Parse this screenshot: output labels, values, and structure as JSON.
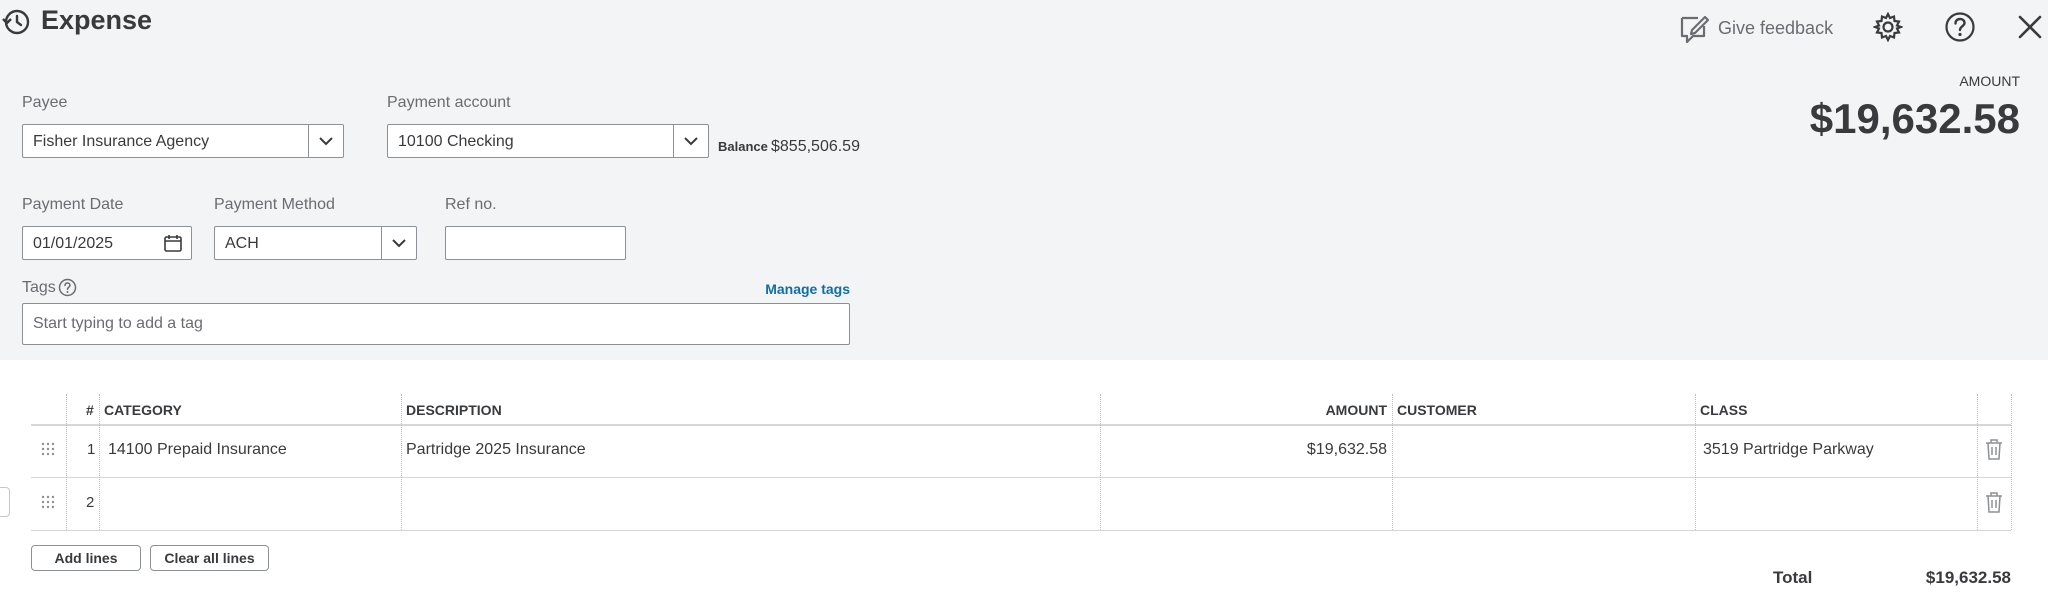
{
  "header": {
    "title": "Expense",
    "feedback_label": "Give feedback"
  },
  "amount": {
    "label": "AMOUNT",
    "value": "$19,632.58"
  },
  "payee": {
    "label": "Payee",
    "value": "Fisher Insurance Agency"
  },
  "payment_account": {
    "label": "Payment account",
    "value": "10100 Checking",
    "balance_label": "Balance",
    "balance_value": "$855,506.59"
  },
  "payment_date": {
    "label": "Payment Date",
    "value": "01/01/2025"
  },
  "payment_method": {
    "label": "Payment Method",
    "value": "ACH"
  },
  "ref_no": {
    "label": "Ref no.",
    "value": ""
  },
  "tags": {
    "label": "Tags",
    "manage_label": "Manage tags",
    "placeholder": "Start typing to add a tag"
  },
  "table": {
    "headers": {
      "num": "#",
      "category": "CATEGORY",
      "description": "DESCRIPTION",
      "amount": "AMOUNT",
      "customer": "CUSTOMER",
      "class": "CLASS"
    },
    "rows": [
      {
        "num": "1",
        "category": "14100 Prepaid Insurance",
        "description": "Partridge 2025 Insurance",
        "amount": "$19,632.58",
        "customer": "",
        "class": "3519 Partridge Parkway"
      },
      {
        "num": "2",
        "category": "",
        "description": "",
        "amount": "",
        "customer": "",
        "class": ""
      }
    ]
  },
  "buttons": {
    "add_lines": "Add lines",
    "clear_all_lines": "Clear all lines"
  },
  "total": {
    "label": "Total",
    "value": "$19,632.58"
  },
  "colors": {
    "background_top": "#f3f4f6",
    "link": "#0d6fa7",
    "text": "#393a3d"
  }
}
